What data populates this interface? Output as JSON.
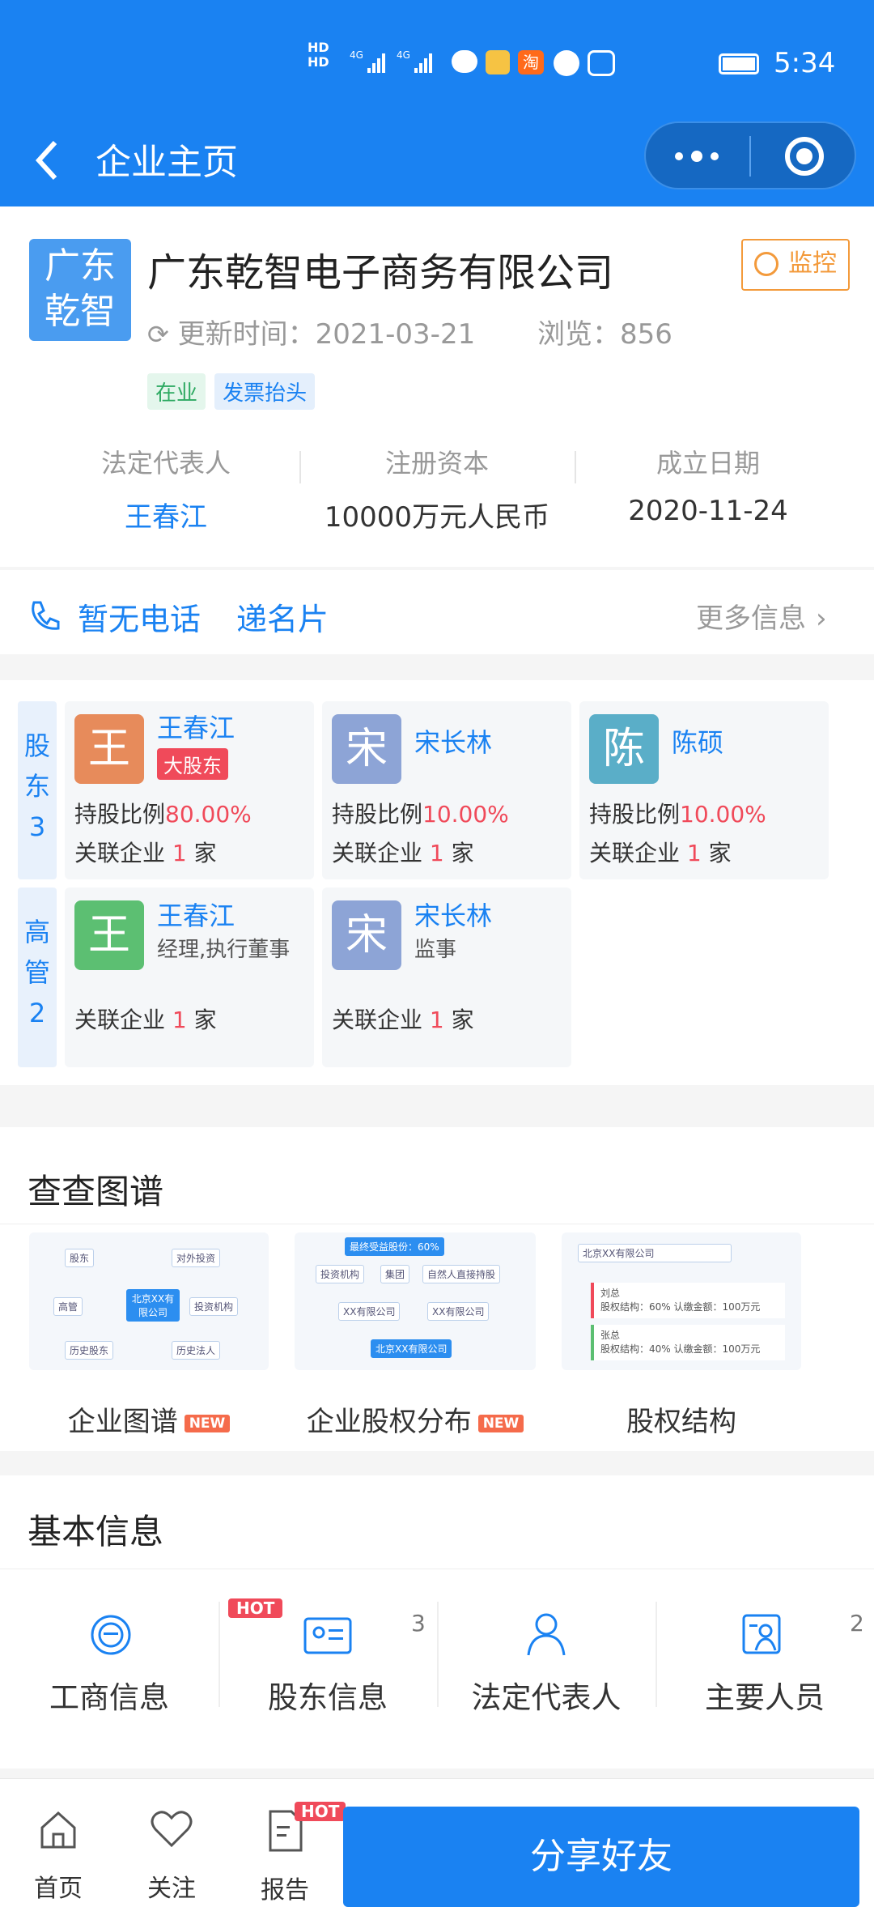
{
  "status_bar": {
    "time": "5:34",
    "taobao_label": "淘"
  },
  "nav": {
    "title": "企业主页"
  },
  "company": {
    "logo_line1": "广东",
    "logo_line2": "乾智",
    "name": "广东乾智电子商务有限公司",
    "monitor_label": "监控",
    "update_label": "更新时间：2021-03-21",
    "views_label": "浏览：856",
    "tags": [
      "在业",
      "发票抬头"
    ],
    "info": [
      {
        "label": "法定代表人",
        "value": "王春江"
      },
      {
        "label": "注册资本",
        "value": "10000万元人民币"
      },
      {
        "label": "成立日期",
        "value": "2020-11-24"
      }
    ]
  },
  "contact": {
    "phone": "暂无电话",
    "card": "递名片",
    "more": "更多信息"
  },
  "shareholders": {
    "section_label": [
      "股",
      "东",
      "3"
    ],
    "items": [
      {
        "avatar": "王",
        "name": "王春江",
        "badge": "大股东",
        "ratio_label": "持股比例",
        "ratio": "80.00%",
        "related_prefix": "关联企业 ",
        "related_count": "1",
        "related_suffix": " 家",
        "color": "#e78b5b"
      },
      {
        "avatar": "宋",
        "name": "宋长林",
        "ratio_label": "持股比例",
        "ratio": "10.00%",
        "related_prefix": "关联企业 ",
        "related_count": "1",
        "related_suffix": " 家",
        "color": "#8da4d6"
      },
      {
        "avatar": "陈",
        "name": "陈硕",
        "ratio_label": "持股比例",
        "ratio": "10.00%",
        "related_prefix": "关联企业 ",
        "related_count": "1",
        "related_suffix": " 家",
        "color": "#5aaec8"
      }
    ]
  },
  "executives": {
    "section_label": [
      "高",
      "管",
      "2"
    ],
    "items": [
      {
        "avatar": "王",
        "name": "王春江",
        "role": "经理,执行董事",
        "related_prefix": "关联企业 ",
        "related_count": "1",
        "related_suffix": " 家",
        "color": "#5cbf72"
      },
      {
        "avatar": "宋",
        "name": "宋长林",
        "role": "监事",
        "related_prefix": "关联企业 ",
        "related_count": "1",
        "related_suffix": " 家",
        "color": "#8da4d6"
      }
    ]
  },
  "graph": {
    "title": "查查图谱",
    "items": [
      {
        "label": "企业图谱",
        "badge": "NEW"
      },
      {
        "label": "企业股权分布",
        "badge": "NEW"
      },
      {
        "label": "股权结构",
        "badge": ""
      }
    ],
    "thumb1": {
      "center": "北京XX有限公司",
      "nodes": [
        "股东",
        "对外投资",
        "高管",
        "投资机构",
        "历史股东",
        "历史法人"
      ]
    },
    "thumb2": {
      "top": "最终受益股份：60%",
      "row1": [
        "投资机构",
        "集团",
        "自然人直接持股"
      ],
      "row2": [
        "XX有限公司",
        "XX有限公司"
      ],
      "bottom": "北京XX有限公司"
    },
    "thumb3": {
      "company": "北京XX有限公司",
      "p1": "刘总",
      "p1_detail": "股权结构：60%  认缴金额：100万元",
      "p2": "张总",
      "p2_detail": "股权结构：40%  认缴金额：100万元"
    }
  },
  "basic": {
    "title": "基本信息",
    "items": [
      {
        "label": "工商信息",
        "badge": "",
        "count": ""
      },
      {
        "label": "股东信息",
        "badge": "HOT",
        "count": "3"
      },
      {
        "label": "法定代表人",
        "badge": "",
        "count": ""
      },
      {
        "label": "主要人员",
        "badge": "",
        "count": "2"
      }
    ]
  },
  "tabbar": {
    "home": "首页",
    "follow": "关注",
    "report": "报告",
    "report_badge": "HOT",
    "share": "分享好友"
  },
  "colors": {
    "primary": "#1a82f2",
    "accent_red": "#f04a5a",
    "monitor_orange": "#f39a3b"
  }
}
